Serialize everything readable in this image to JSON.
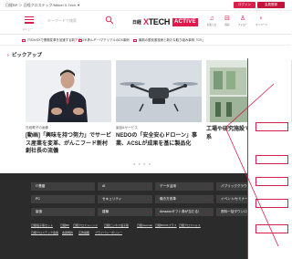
{
  "topbar": {
    "crumb": "日経BP ＞ 日経クロステック/Nikkei X-Tech ▼",
    "login": "ログイン",
    "register": "会員登録"
  },
  "header": {
    "menu_label": "メニュー",
    "search_placeholder": "キーワードで検索",
    "logo_nikkei": "日経",
    "logo_xtech_x": "X",
    "logo_xtech_rest": "TECH",
    "logo_active": "ACTIVE",
    "icons": [
      {
        "name": "bell-icon",
        "glyph": "♫",
        "label": "お知らせ"
      },
      {
        "name": "bookmark-icon",
        "glyph": "⊟",
        "label": "保存"
      },
      {
        "name": "topics-icon",
        "glyph": "♙",
        "label": "フォロー"
      },
      {
        "name": "user-icon",
        "glyph": "♀",
        "label": "マイページ"
      }
    ]
  },
  "ticker": [
    "IT/DX/GXで業務変革を加速する新アプローチ",
    "エネルギー/マテリアルのDX事例",
    "最新の脱炭素技術と新たな取り組み事例「GX」"
  ],
  "pickup": {
    "heading": "ピックアップ",
    "cards": [
      {
        "tag": "日経電子の画像",
        "title": "[動画]「興味を持つ努力」でサービス産業を変革、がんこフード新村創社長の流儀"
      },
      {
        "tag": "製品&サービス",
        "title": "NEDOの「安全安心ドローン」事業、ACSLが成果を基に製品化"
      },
      {
        "tag": "",
        "title": "工場や研究施設での稼働をン樹脂系"
      }
    ],
    "pager": "● ● ● ●"
  },
  "footer": {
    "buttons": [
      [
        "IT基盤",
        "AI",
        "データ活用",
        "パブリッククラウド"
      ],
      [
        "PC",
        "セキュリティ",
        "働き方改革",
        "イベント/セミナー"
      ],
      [
        "製造",
        "建築",
        "Amazonギフト券が当たる！",
        "資料一括ダウンロード"
      ]
    ],
    "links_row1": [
      "日経電子版セット",
      "日経BP",
      "日経クロストレンド",
      "日経ビジネス電子版",
      "日経xwoman",
      "日経BOOKプラス",
      "日経クロスヘルス"
    ],
    "links_row2": [
      "日経クロステック会員",
      "会員規約",
      "広告掲載",
      "プライバシーポリシー"
    ]
  },
  "colors": {
    "accent": "#e0194d",
    "footer_bg": "#2b2b2b",
    "footer_button": "#3f3f3f"
  }
}
